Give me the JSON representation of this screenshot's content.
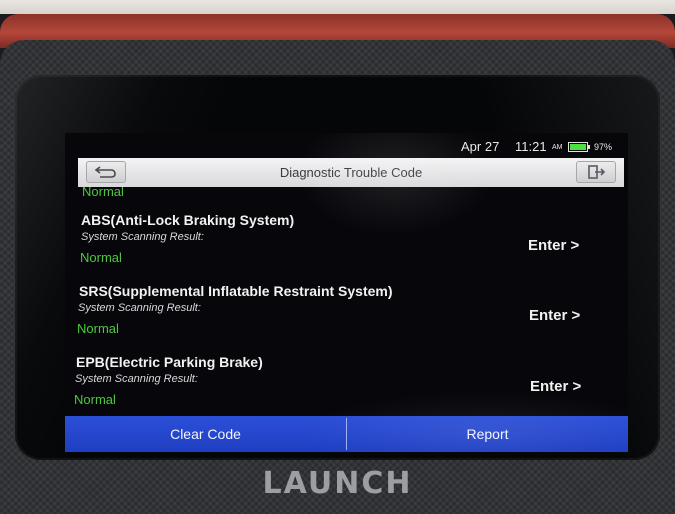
{
  "status": {
    "date": "Apr 27",
    "time": "11:21",
    "ampm": "AM",
    "battery_pct": "97%",
    "battery_level": 0.97
  },
  "header": {
    "title": "Diagnostic Trouble Code"
  },
  "list": {
    "top_result": "Normal",
    "items": [
      {
        "name": "ABS(Anti-Lock Braking System)",
        "scan_label": "System Scanning Result:",
        "result": "Normal",
        "action": "Enter >"
      },
      {
        "name": "SRS(Supplemental Inflatable Restraint System)",
        "scan_label": "System Scanning Result:",
        "result": "Normal",
        "action": "Enter >"
      },
      {
        "name": "EPB(Electric Parking Brake)",
        "scan_label": "System Scanning Result:",
        "result": "Normal",
        "action": "Enter >"
      }
    ]
  },
  "footer": {
    "clear_code": "Clear Code",
    "report": "Report"
  },
  "device": {
    "brand": "LAUNCH"
  },
  "colors": {
    "normal_green": "#4cc83d",
    "action_bar_blue": "#2c4fd8",
    "device_red": "#b5473a"
  }
}
